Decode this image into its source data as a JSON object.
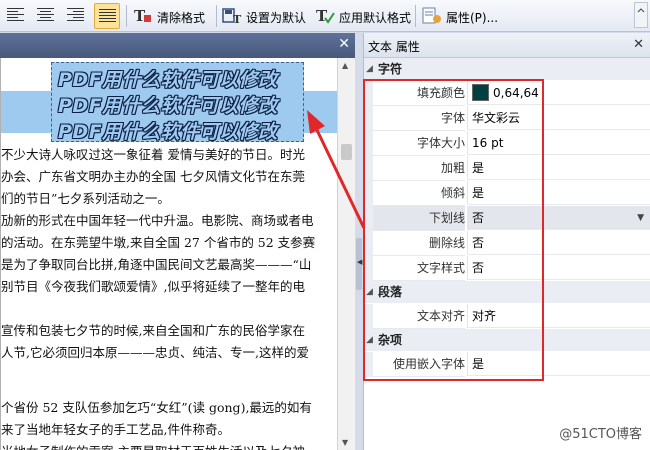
{
  "toolbar": {
    "align_buttons": [
      "align-left",
      "align-center",
      "align-right",
      "align-justify"
    ],
    "active_align": "align-justify",
    "clear_format": "清除格式",
    "set_default": "设置为默认",
    "apply_default": "应用默认格式",
    "properties": "属性(P)..."
  },
  "document": {
    "art_lines": [
      "PDF用什么软件可以修改",
      "PDF用什么软件可以修改",
      "PDF用什么软件可以修改"
    ],
    "body_lines": [
      "不少大诗人咏叹过这一象征着 爱情与美好的节日。时光",
      "办会、广东省文明办主办的全国  七夕风情文化节在东莞",
      "们的节日”七夕系列活动之一。",
      "劢新的形式在中国年轻一代中升温。电影院、商场或者电",
      "的活动。在东莞望牛墩,来自全国 27 个省市的 52 支参赛",
      "是为了争取同台比拼,角逐中国民间文艺最高奖———“山",
      "别节目《今夜我们歌颂爱情》,似乎将延续了一整年的电",
      "",
      "宣传和包装七夕节的时候,来自全国和广东的民俗学家在",
      "人节,它必须回归本原———忠贞、纯洁、专一,这样的爱",
      "",
      "",
      "个省份 52 支队伍参加乞巧“女红”(读 gong),最远的如有",
      "来了当地年轻女子的手工艺品,件件称奇。",
      "当地女子制作的贡案,主要是取材于百姓生活以及七夕神"
    ]
  },
  "panel": {
    "title": "文本 属性",
    "categories": {
      "character": "字符",
      "paragraph": "段落",
      "misc": "杂项"
    },
    "rows": {
      "fill_color": {
        "name": "填充颜色",
        "value": "0,64,64",
        "color": "#004040"
      },
      "font": {
        "name": "字体",
        "value": "华文彩云"
      },
      "font_size": {
        "name": "字体大小",
        "value": "16 pt"
      },
      "bold": {
        "name": "加粗",
        "value": "是"
      },
      "italic": {
        "name": "倾斜",
        "value": "是"
      },
      "underline": {
        "name": "下划线",
        "value": "否"
      },
      "strikethrough": {
        "name": "删除线",
        "value": "否"
      },
      "text_style": {
        "name": "文字样式",
        "value": "否"
      },
      "text_align": {
        "name": "文本对齐",
        "value": "对齐"
      },
      "embed_font": {
        "name": "使用嵌入字体",
        "value": "是"
      }
    }
  },
  "watermark": "@51CTO博客",
  "colors": {
    "highlight": "#9fcaf0",
    "annotation": "#e02828",
    "doc_topbar": "#4d5f84"
  }
}
